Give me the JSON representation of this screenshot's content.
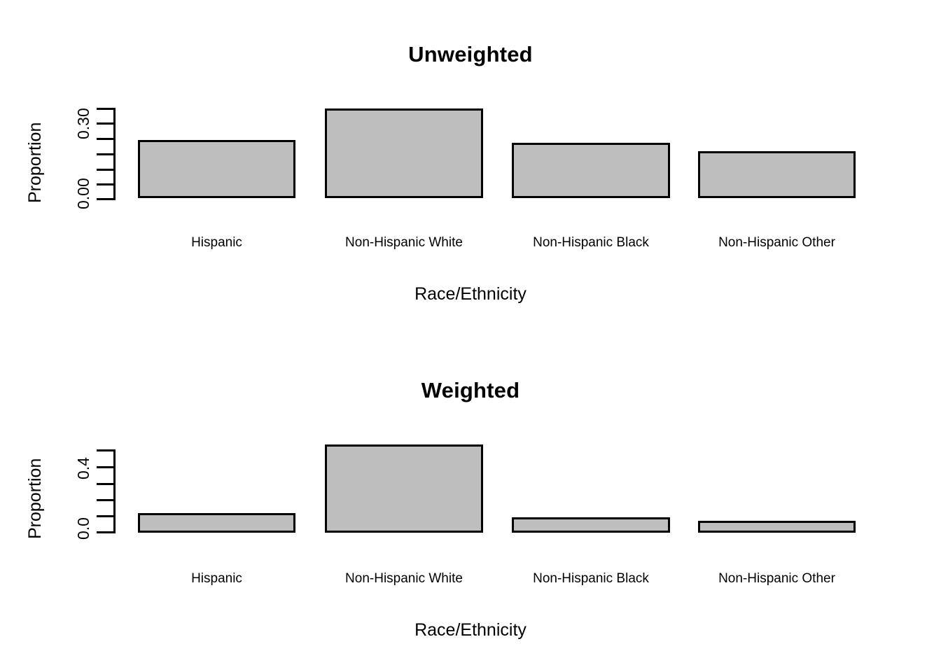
{
  "figure": {
    "background": "#ffffff",
    "bar_fill": "#bebebe",
    "bar_border": "#000000"
  },
  "panels": [
    {
      "id": "unweighted",
      "title": "Unweighted",
      "ylabel": "Proportion",
      "xlabel": "Race/Ethnicity",
      "ytick_labels": [
        "0.00",
        "0.30"
      ]
    },
    {
      "id": "weighted",
      "title": "Weighted",
      "ylabel": "Proportion",
      "xlabel": "Race/Ethnicity",
      "ytick_labels": [
        "0.0",
        "0.4"
      ]
    }
  ],
  "categories": [
    "Hispanic",
    "Non-Hispanic White",
    "Non-Hispanic Black",
    "Non-Hispanic Other"
  ],
  "chart_data": [
    {
      "type": "bar",
      "title": "Unweighted",
      "xlabel": "Race/Ethnicity",
      "ylabel": "Proportion",
      "categories": [
        "Hispanic",
        "Non-Hispanic White",
        "Non-Hispanic Black",
        "Non-Hispanic Other"
      ],
      "values": [
        0.192,
        0.296,
        0.182,
        0.155
      ],
      "ylim": [
        0.0,
        0.3
      ],
      "yticks": [
        0.0,
        0.05,
        0.1,
        0.15,
        0.2,
        0.25,
        0.3
      ],
      "ytick_labels_shown": [
        "0.00",
        "0.30"
      ],
      "grid": false,
      "legend": null
    },
    {
      "type": "bar",
      "title": "Weighted",
      "xlabel": "Race/Ethnicity",
      "ylabel": "Proportion",
      "categories": [
        "Hispanic",
        "Non-Hispanic White",
        "Non-Hispanic Black",
        "Non-Hispanic Other"
      ],
      "values": [
        0.12,
        0.538,
        0.094,
        0.073
      ],
      "ylim": [
        0.0,
        0.5
      ],
      "yticks": [
        0.0,
        0.1,
        0.2,
        0.3,
        0.4,
        0.5
      ],
      "ytick_labels_shown": [
        "0.0",
        "0.4"
      ],
      "grid": false,
      "legend": null
    }
  ]
}
